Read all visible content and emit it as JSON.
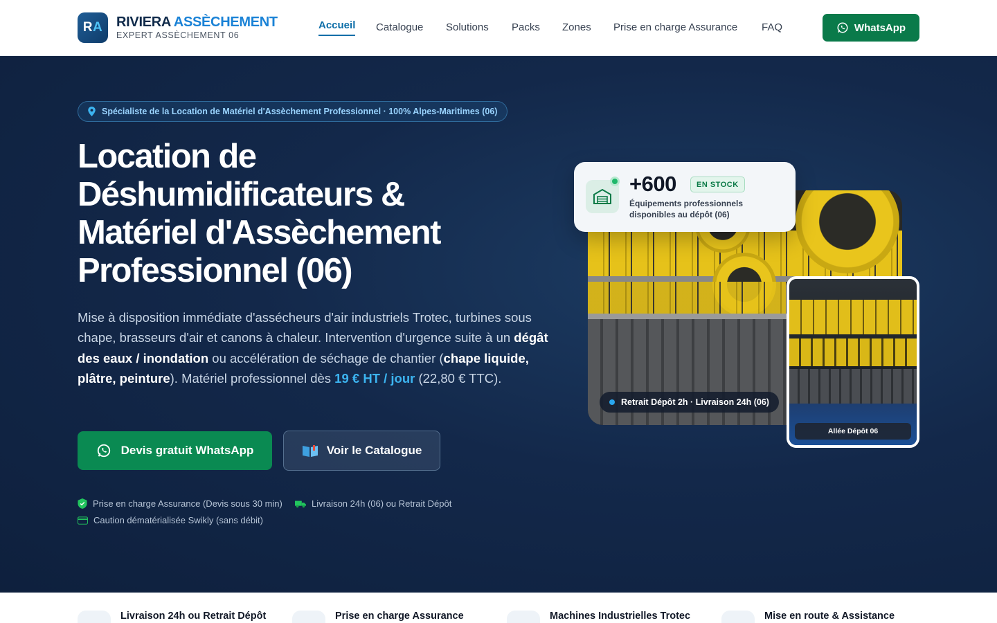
{
  "header": {
    "logo_mark_r": "R",
    "logo_mark_a": "A",
    "logo_title_a": "RIVIERA ",
    "logo_title_b": "ASSÈCHEMENT",
    "logo_subtitle": "EXPERT ASSÈCHEMENT 06",
    "nav": [
      {
        "label": "Accueil",
        "active": true
      },
      {
        "label": "Catalogue"
      },
      {
        "label": "Solutions"
      },
      {
        "label": "Packs"
      },
      {
        "label": "Zones"
      },
      {
        "label": "Prise en charge Assurance"
      },
      {
        "label": "FAQ"
      }
    ],
    "whatsapp_label": "WhatsApp"
  },
  "hero": {
    "pill": "Spécialiste de la Location de Matériel d'Assèchement Professionnel · 100% Alpes-Maritimes (06)",
    "title_line1": "Location de",
    "title_line2": "Déshumidificateurs &",
    "title_line3": "Matériel d'Assèchement",
    "title_line4": "Professionnel (06)",
    "lead_1": "Mise à disposition immédiate d'assécheurs d'air industriels Trotec, turbines sous chape, brasseurs d'air et canons à chaleur. Intervention d'urgence suite à un ",
    "lead_b1": "dégât des eaux / inondation",
    "lead_2": " ou accélération de séchage de chantier (",
    "lead_b2": "chape liquide, plâtre, peinture",
    "lead_3": "). Matériel professionnel dès ",
    "lead_price": "19 € HT / jour",
    "lead_4": " (22,80 € TTC).",
    "cta_primary": "Devis gratuit WhatsApp",
    "cta_secondary": "Voir le Catalogue",
    "features": [
      "Prise en charge Assurance (Devis sous 30 min)",
      "Livraison 24h (06) ou Retrait Dépôt",
      "Caution dématérialisée Swikly (sans débit)"
    ]
  },
  "stock_card": {
    "number": "+600",
    "badge": "EN STOCK",
    "description": "Équipements professionnels disponibles au dépôt (06)"
  },
  "photo_tag": "Retrait Dépôt 2h · Livraison 24h (06)",
  "small_photo_tag": "Allée Dépôt 06",
  "strip": [
    "Livraison 24h ou Retrait Dépôt",
    "Prise en charge Assurance",
    "Machines Industrielles Trotec",
    "Mise en route & Assistance"
  ],
  "colors": {
    "brand_blue": "#1a82d6",
    "whatsapp_green": "#0a7a4a",
    "hero_bg": "#13284a",
    "price_blue": "#3cb4f0"
  }
}
